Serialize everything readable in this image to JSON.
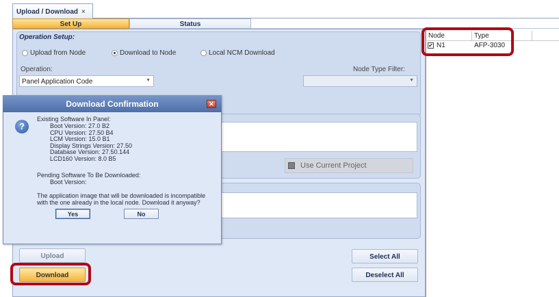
{
  "tab": {
    "title": "Upload / Download",
    "close": "×"
  },
  "subtabs": {
    "setup": "Set Up",
    "status": "Status"
  },
  "operation_setup": {
    "title": "Operation Setup:",
    "radio_upload": "Upload from Node",
    "radio_download": "Download to Node",
    "radio_local": "Local NCM Download",
    "operation_label": "Operation:",
    "operation_value": "Panel Application Code",
    "node_type_filter_label": "Node Type Filter:",
    "node_type_filter_value": ""
  },
  "use_current_project": "Use Current Project",
  "buttons": {
    "upload": "Upload",
    "download": "Download",
    "select_all": "Select All",
    "deselect_all": "Deselect All"
  },
  "grid": {
    "headers": [
      "Node",
      "Type"
    ],
    "rows": [
      {
        "node": "N1",
        "type": "AFP-3030",
        "checked": true
      }
    ],
    "check_glyph": "✔"
  },
  "dialog": {
    "title": "Download Confirmation",
    "close": "✕",
    "icon": "question-icon",
    "icon_glyph": "?",
    "existing_header": "Existing Software In Panel:",
    "existing_lines": [
      "Boot Version: 27.0 B2",
      "CPU Version: 27.50 B4",
      "LCM Version: 15.0 B1",
      "Display Strings Version: 27.50",
      "Database Version: 27.50.144",
      "LCD160 Version: 8.0 B5"
    ],
    "pending_header": "Pending Software To Be Downloaded:",
    "pending_lines": [
      "Boot Version:"
    ],
    "message_line1": "The application image that will be downloaded is incompatible",
    "message_line2": "with the one already in the local node.  Download it anyway?",
    "yes": "Yes",
    "no": "No"
  },
  "colors": {
    "highlight": "#b00a14",
    "accent_orange": "#f6b43a",
    "panel_blue": "#dfe8f6"
  }
}
